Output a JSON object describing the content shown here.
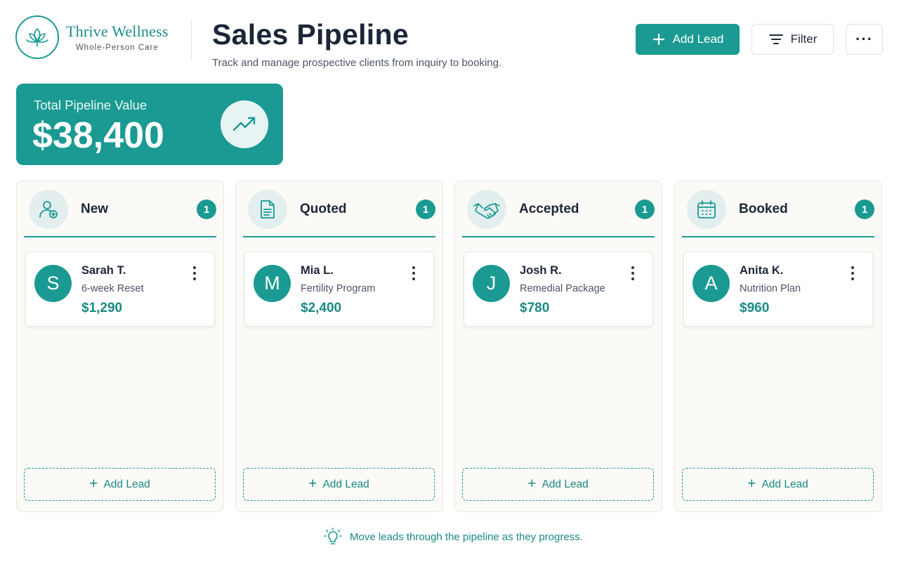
{
  "brand": {
    "name": "Thrive Wellness",
    "tagline": "Whole-Person Care",
    "logo_icon": "lotus-icon"
  },
  "header": {
    "title": "Sales Pipeline",
    "subtitle": "Track and manage prospective clients from inquiry to booking.",
    "add_lead_label": "Add Lead",
    "filter_label": "Filter",
    "more_label": "···"
  },
  "summary": {
    "label": "Total Pipeline Value",
    "value": "$38,400",
    "icon": "trending-up-icon"
  },
  "columns": [
    {
      "title": "New",
      "count": "1",
      "icon": "user-plus-icon",
      "lead": {
        "initial": "S",
        "name": "Sarah T.",
        "program": "6-week Reset",
        "value": "$1,290"
      },
      "add_label": "Add Lead"
    },
    {
      "title": "Quoted",
      "count": "1",
      "icon": "document-icon",
      "lead": {
        "initial": "M",
        "name": "Mia L.",
        "program": "Fertility Program",
        "value": "$2,400"
      },
      "add_label": "Add Lead"
    },
    {
      "title": "Accepted",
      "count": "1",
      "icon": "handshake-icon",
      "lead": {
        "initial": "J",
        "name": "Josh R.",
        "program": "Remedial Package",
        "value": "$780"
      },
      "add_label": "Add Lead"
    },
    {
      "title": "Booked",
      "count": "1",
      "icon": "calendar-icon",
      "lead": {
        "initial": "A",
        "name": "Anita K.",
        "program": "Nutrition Plan",
        "value": "$960"
      },
      "add_label": "Add Lead"
    }
  ],
  "footer": {
    "hint": "Move leads through the pipeline as they progress.",
    "icon": "lightbulb-icon"
  },
  "colors": {
    "accent": "#1a9a92",
    "accent_text": "#1a8a84",
    "column_bg": "#fcfaf6",
    "title_text": "#1b2638"
  }
}
